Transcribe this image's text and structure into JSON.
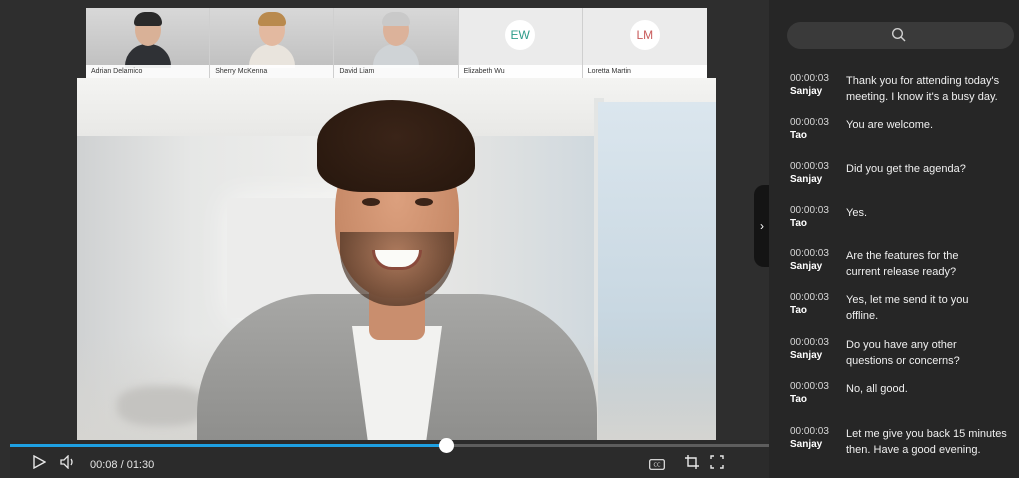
{
  "participants": [
    {
      "name": "Adrian Delamico",
      "type": "photo",
      "icon": "avatar-photo",
      "skin": "#d2a88c",
      "suit": "#2f3135",
      "hair": "#2a2a2a"
    },
    {
      "name": "Sherry McKenna",
      "type": "photo",
      "icon": "avatar-photo",
      "skin": "#e3b9a0",
      "suit": "#e9e4dd",
      "hair": "#b98a4e"
    },
    {
      "name": "David Liam",
      "type": "photo",
      "icon": "avatar-photo",
      "skin": "#dcb29a",
      "suit": "#cfd3d6",
      "hair": "#c9c9c9"
    },
    {
      "name": "Elizabeth Wu",
      "type": "initials",
      "initials": "EW",
      "color": "#2e9c8a"
    },
    {
      "name": "Loretta Martin",
      "type": "initials",
      "initials": "LM",
      "color": "#c85a5a"
    }
  ],
  "player": {
    "current_time": "00:08",
    "duration": "01:30",
    "time_display": "00:08 / 01:30",
    "progress_fraction": 0.574,
    "icons": [
      "play-icon",
      "volume-icon",
      "closed-captions-icon",
      "crop-icon",
      "fullscreen-icon"
    ],
    "accent_color": "#1ea0e2"
  },
  "transcript": {
    "search_icon": "search-icon",
    "collapse_icon": "chevron-right-icon",
    "entries": [
      {
        "time": "00:00:03",
        "speaker": "Sanjay",
        "text": "Thank you for attending today's\nmeeting. I know it's a busy day."
      },
      {
        "time": "00:00:03",
        "speaker": "Tao",
        "text": " You are welcome."
      },
      {
        "time": "00:00:03",
        "speaker": "Sanjay",
        "text": "Did you get the agenda?"
      },
      {
        "time": "00:00:03",
        "speaker": "Tao",
        "text": "Yes."
      },
      {
        "time": "00:00:03",
        "speaker": "Sanjay",
        "text": "Are the features for the\ncurrent release ready?"
      },
      {
        "time": "00:00:03",
        "speaker": "Tao",
        "text": "Yes, let me send it to you\noffline."
      },
      {
        "time": "00:00:03",
        "speaker": "Sanjay",
        "text": "Do you have any other\nquestions or concerns?"
      },
      {
        "time": "00:00:03",
        "speaker": "Tao",
        "text": "No, all good."
      },
      {
        "time": "00:00:03",
        "speaker": "Sanjay",
        "text": "Let me give you back 15 minutes\nthen. Have a good evening."
      }
    ]
  }
}
